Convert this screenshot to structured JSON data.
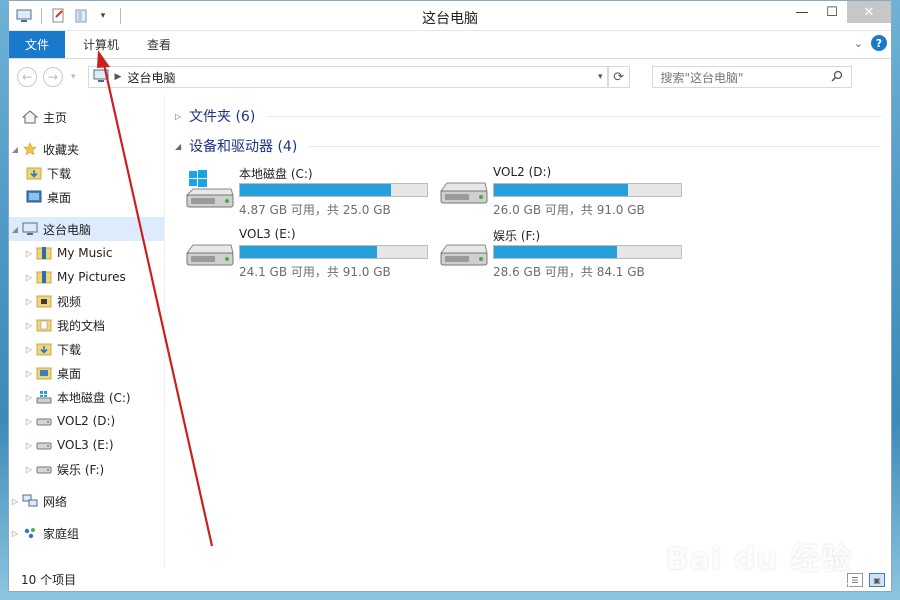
{
  "window": {
    "title": "这台电脑",
    "buttons": {
      "minimize": "—",
      "maximize": "☐",
      "close": "✕"
    }
  },
  "ribbon": {
    "tabs": [
      {
        "label": "文件"
      },
      {
        "label": "计算机"
      },
      {
        "label": "查看"
      }
    ],
    "help": "?"
  },
  "addressbar": {
    "breadcrumb": "这台电脑",
    "search_placeholder": "搜索\"这台电脑\""
  },
  "nav": {
    "quick": {
      "label": "主页"
    },
    "favorites": {
      "label": "收藏夹",
      "items": [
        {
          "label": "下载"
        },
        {
          "label": "桌面"
        }
      ]
    },
    "computer": {
      "label": "这台电脑",
      "items": [
        {
          "label": "My Music"
        },
        {
          "label": "My Pictures"
        },
        {
          "label": "视频"
        },
        {
          "label": "我的文档"
        },
        {
          "label": "下载"
        },
        {
          "label": "桌面"
        },
        {
          "label": "本地磁盘 (C:)"
        },
        {
          "label": "VOL2 (D:)"
        },
        {
          "label": "VOL3 (E:)"
        },
        {
          "label": "娱乐 (F:)"
        }
      ]
    },
    "network": {
      "label": "网络"
    },
    "homegroup": {
      "label": "家庭组"
    }
  },
  "content": {
    "folders_header": "文件夹 (6)",
    "devices_header": "设备和驱动器 (4)",
    "drives": [
      {
        "name": "本地磁盘 (C:)",
        "size": "4.87 GB 可用，共 25.0 GB",
        "used_fraction": 0.805,
        "icon": "windows-drive-icon"
      },
      {
        "name": "VOL2 (D:)",
        "size": "26.0 GB 可用，共 91.0 GB",
        "used_fraction": 0.714,
        "icon": "hard-drive-icon"
      },
      {
        "name": "VOL3 (E:)",
        "size": "24.1 GB 可用，共 91.0 GB",
        "used_fraction": 0.735,
        "icon": "hard-drive-icon"
      },
      {
        "name": "娱乐 (F:)",
        "size": "28.6 GB 可用，共 84.1 GB",
        "used_fraction": 0.66,
        "icon": "hard-drive-icon"
      }
    ]
  },
  "status": {
    "items_count": "10 个项目"
  },
  "watermark": {
    "brand": "Bai du 经验",
    "url": "jingyan.baidu.com"
  },
  "colors": {
    "accent": "#1979ca",
    "bar_fill": "#26a0da",
    "header_text": "#1e3287",
    "annotation_arrow": "#cc1f1f"
  }
}
